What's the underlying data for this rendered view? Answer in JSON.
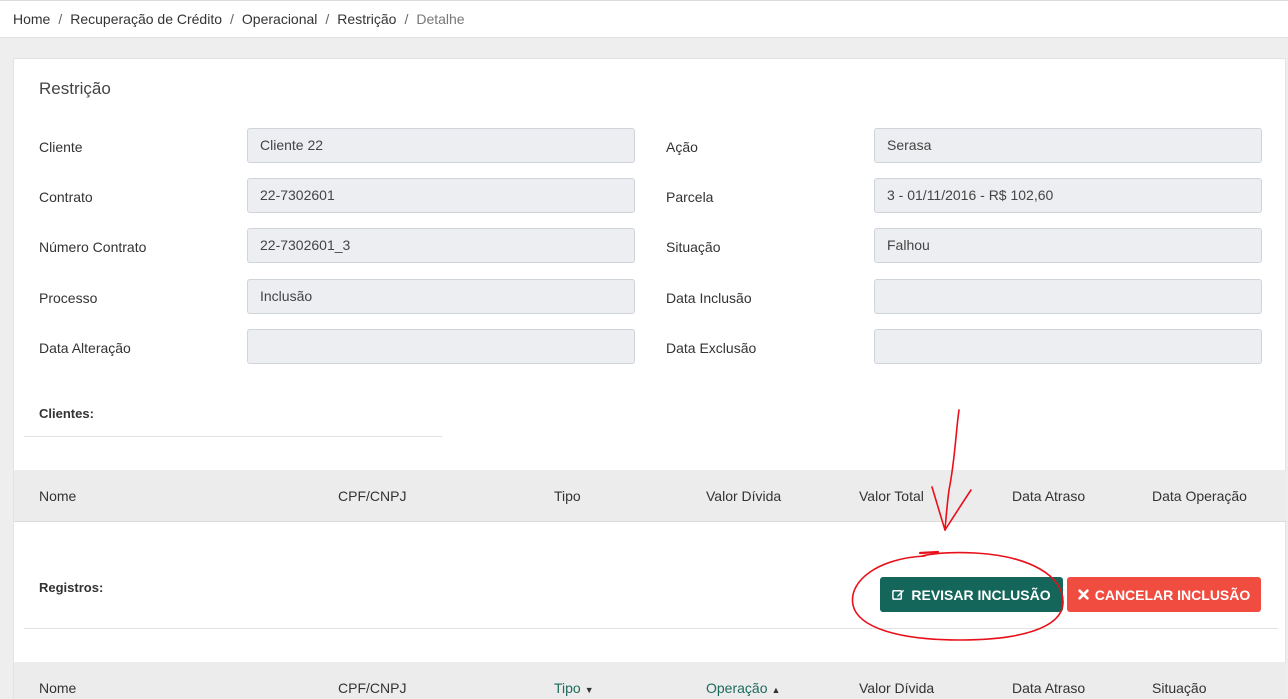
{
  "breadcrumb": [
    "Home",
    "Recuperação de Crédito",
    "Operacional",
    "Restrição",
    "Detalhe"
  ],
  "panel_title": "Restrição",
  "fields_left": [
    {
      "label": "Cliente",
      "value": "Cliente 22"
    },
    {
      "label": "Contrato",
      "value": "22-7302601"
    },
    {
      "label": "Número Contrato",
      "value": "22-7302601_3"
    },
    {
      "label": "Processo",
      "value": "Inclusão"
    },
    {
      "label": "Data Alteração",
      "value": ""
    }
  ],
  "fields_right": [
    {
      "label": "Ação",
      "value": "Serasa"
    },
    {
      "label": "Parcela",
      "value": "3 - 01/11/2016 - R$ 102,60"
    },
    {
      "label": "Situação",
      "value": "Falhou"
    },
    {
      "label": "Data Inclusão",
      "value": ""
    },
    {
      "label": "Data Exclusão",
      "value": ""
    }
  ],
  "clientes": {
    "label": "Clientes:",
    "columns": [
      "Nome",
      "CPF/CNPJ",
      "Tipo",
      "Valor Dívida",
      "Valor Total",
      "Data Atraso",
      "Data Operação"
    ]
  },
  "registros": {
    "label": "Registros:",
    "columns": [
      "Nome",
      "CPF/CNPJ",
      "Tipo",
      "Operação",
      "Valor Dívida",
      "Data Atraso",
      "Situação"
    ],
    "sort": {
      "Tipo": "desc",
      "Operação": "asc"
    }
  },
  "buttons": {
    "revisar": "REVISAR INCLUSÃO",
    "cancelar": "CANCELAR INCLUSÃO"
  },
  "icons": {
    "revisar": "edit-icon",
    "cancelar": "close-icon"
  },
  "colors": {
    "primary_green": "#14665a",
    "danger_red": "#f14c40",
    "annotation_red": "#e8101a"
  }
}
